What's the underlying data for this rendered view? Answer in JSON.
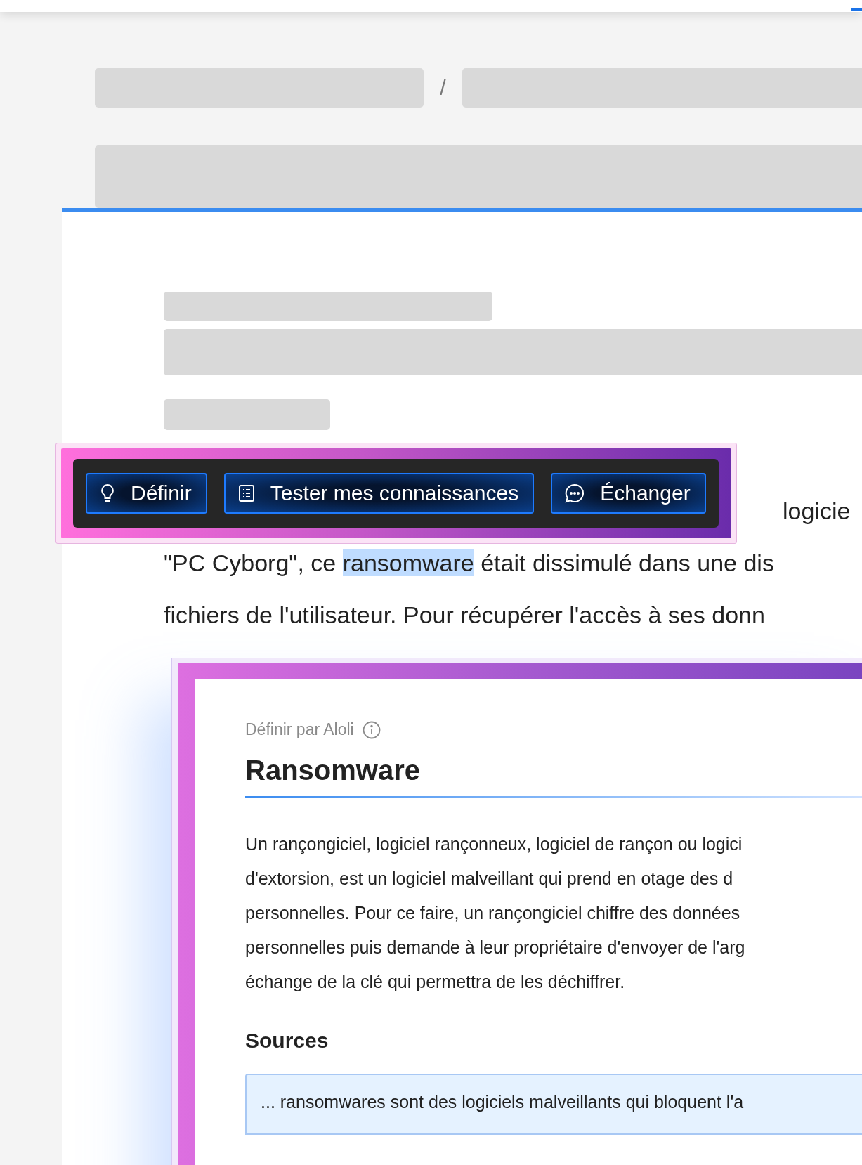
{
  "breadcrumb": {
    "separator": "/"
  },
  "toolbar": {
    "buttons": [
      {
        "kind": "define",
        "label": "Définir"
      },
      {
        "kind": "quiz",
        "label": "Tester mes connaissances"
      },
      {
        "kind": "chat",
        "label": "Échanger"
      }
    ]
  },
  "article": {
    "partial_line": "logicie",
    "lines": [
      [
        {
          "text": "\"PC Cyborg\", ce ",
          "highlighted": false
        },
        {
          "text": "ransomware",
          "highlighted": true
        },
        {
          "text": " était dissimulé dans une dis",
          "highlighted": false
        }
      ],
      [
        {
          "text": "fichiers de l'utilisateur. Pour récupérer l'accès à ses donn",
          "highlighted": false
        }
      ]
    ]
  },
  "definition_card": {
    "attribution": "Définir par Aloli",
    "term": "Ransomware",
    "paragraph_lines": [
      "Un rançongiciel, logiciel rançonneux, logiciel de rançon ou logici",
      "d'extorsion, est un logiciel malveillant qui prend en otage des d",
      "personnelles. Pour ce faire, un rançongiciel chiffre des données",
      "personnelles puis demande à leur propriétaire d'envoyer de l'arg",
      "échange de la clé qui permettra de les déchiffrer."
    ],
    "sources_heading": "Sources",
    "source_excerpt": "... ransomwares sont des logiciels malveillants qui bloquent l'a"
  }
}
